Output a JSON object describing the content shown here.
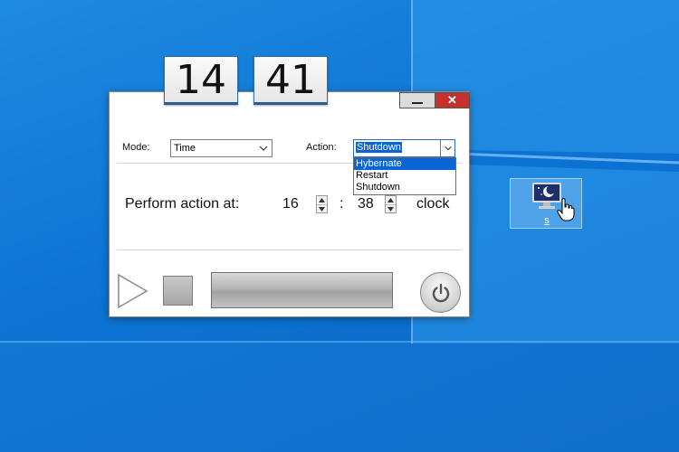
{
  "clock": {
    "hours": "14",
    "minutes": "41"
  },
  "window": {
    "mode_label": "Mode:",
    "mode_value": "Time",
    "action_label": "Action:",
    "action_value": "Shutdown",
    "action_options": [
      "Hybernate",
      "Restart",
      "Shutdown"
    ],
    "perform_label": "Perform action at:",
    "hour_value": "16",
    "separator": ":",
    "minute_value": "38",
    "suffix": "clock",
    "close_glyph": "✕"
  },
  "desktop_icon": {
    "label": "s"
  },
  "icons": {
    "play": "play-icon",
    "stop": "stop-icon",
    "power": "power-icon",
    "chevron": "chevron-down-icon",
    "cursor": "hand-cursor-icon"
  },
  "colors": {
    "accent": "#0a64d6",
    "close": "#c8302d",
    "desktop": "#0d74d4"
  }
}
